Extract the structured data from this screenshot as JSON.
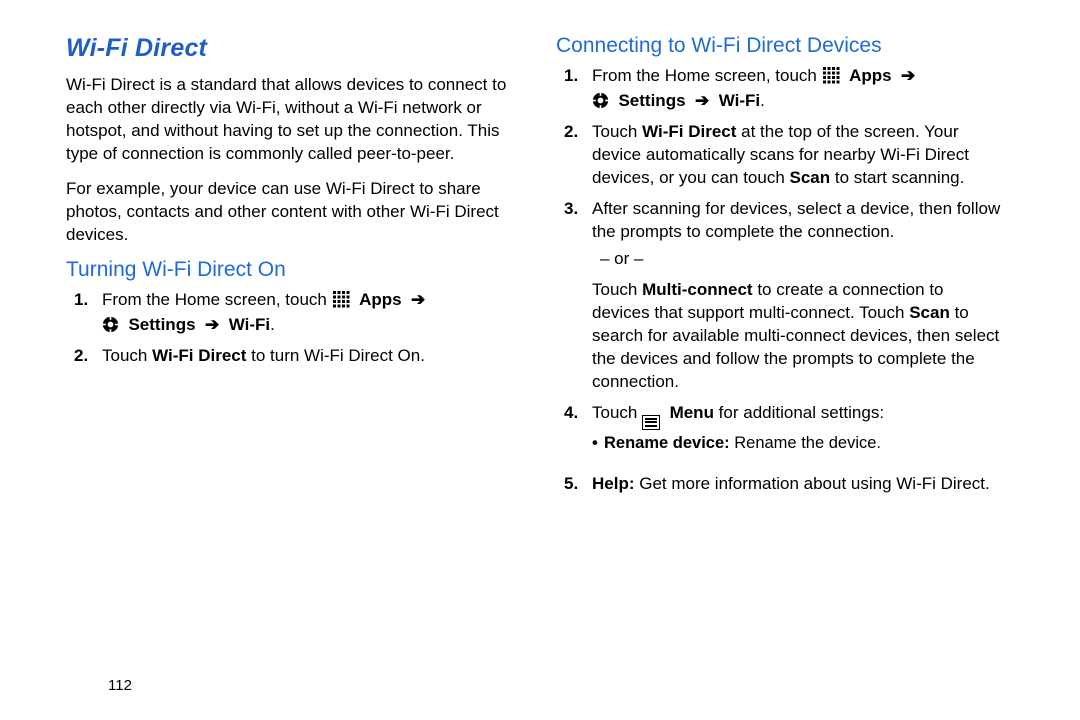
{
  "page_number": "112",
  "title": "Wi-Fi Direct",
  "intro": {
    "p1": "Wi-Fi Direct is a standard that allows devices to connect to each other directly via Wi-Fi, without a Wi-Fi network or hotspot, and without having to set up the connection. This type of connection is commonly called peer-to-peer.",
    "p2": "For example, your device can use Wi-Fi Direct to share photos, contacts and other content with other Wi-Fi Direct devices."
  },
  "arrow": "➔",
  "section_a": {
    "heading": "Turning Wi-Fi Direct On",
    "s1": {
      "num": "1.",
      "lead": "From the Home screen, touch ",
      "apps": "Apps",
      "settings": "Settings",
      "wifi": "Wi-Fi",
      "dot": "."
    },
    "s2": {
      "num": "2.",
      "a": "Touch ",
      "b": "Wi-Fi Direct",
      "c": " to turn Wi-Fi Direct On."
    }
  },
  "section_b": {
    "heading": "Connecting to Wi-Fi Direct Devices",
    "s1": {
      "num": "1.",
      "lead": "From the Home screen, touch ",
      "apps": "Apps",
      "settings": "Settings",
      "wifi": "Wi-Fi",
      "dot": "."
    },
    "s2": {
      "num": "2.",
      "a": "Touch ",
      "b": "Wi-Fi Direct",
      "c": " at the top of the screen. Your device automatically scans for nearby Wi-Fi Direct devices, or you can touch ",
      "d": "Scan",
      "e": " to start scanning."
    },
    "s3": {
      "num": "3.",
      "a": "After scanning for devices, select a device, then follow the prompts to complete the connection.",
      "or": "– or –",
      "b1": "Touch ",
      "b2": "Multi-connect",
      "b3": " to create a connection to devices that support multi-connect. Touch ",
      "b4": "Scan",
      "b5": " to search for available multi-connect devices, then select the devices and follow the prompts to complete the connection."
    },
    "s4": {
      "num": "4.",
      "a": "Touch ",
      "menu": "Menu",
      "b": " for additional settings:",
      "bullet_strong": "Rename device:",
      "bullet_rest": " Rename the device."
    },
    "s5": {
      "num": "5.",
      "strong": "Help:",
      "rest": " Get more information about using Wi-Fi Direct."
    }
  }
}
